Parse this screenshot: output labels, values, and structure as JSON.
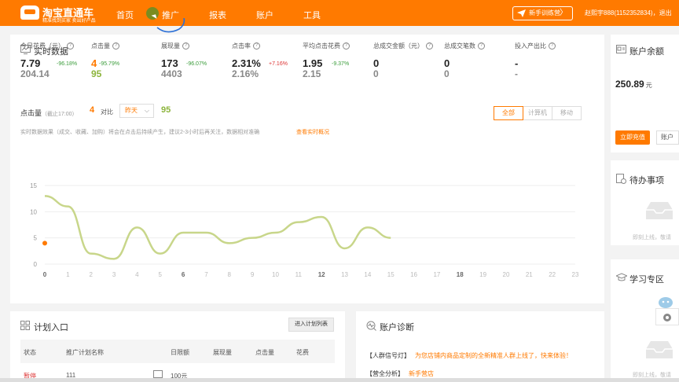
{
  "header": {
    "logo_title": "淘宝直通车",
    "logo_subtitle": "精准找到买家 卖出好产品",
    "nav": [
      "首页",
      "推广",
      "报表",
      "账户",
      "工具"
    ],
    "train_button": "新手训练营",
    "user_info": "赵熙宇888(1152352834)，退出"
  },
  "realtime": {
    "title": "实时数据",
    "metrics": [
      {
        "label": "今日花费（元）",
        "value": "7.79",
        "change": "-96.18%",
        "prev": "204.14",
        "change_dir": "down"
      },
      {
        "label": "点击量",
        "value": "4",
        "change": "-95.79%",
        "prev": "95",
        "change_dir": "down"
      },
      {
        "label": "展现量",
        "value": "173",
        "change": "-96.07%",
        "prev": "4403",
        "change_dir": "down"
      },
      {
        "label": "点击率",
        "value": "2.31%",
        "change": "+7.16%",
        "prev": "2.16%",
        "change_dir": "up"
      },
      {
        "label": "平均点击花费",
        "value": "1.95",
        "change": "-9.37%",
        "prev": "2.15",
        "change_dir": "down"
      },
      {
        "label": "总成交金额（元）",
        "value": "0",
        "change": "",
        "prev": "0",
        "change_dir": "none"
      },
      {
        "label": "总成交笔数",
        "value": "0",
        "change": "",
        "prev": "0",
        "change_dir": "none"
      },
      {
        "label": "投入产出比",
        "value": "-",
        "change": "",
        "prev": "-",
        "change_dir": "none"
      }
    ],
    "clicks_label": "点击量",
    "clicks_time": "（截止17:00）",
    "clicks_today": "4",
    "compare_label": "对比",
    "compare_option": "昨天",
    "clicks_prev": "95",
    "toggles": [
      "全部",
      "计算机",
      "移动"
    ],
    "active_toggle": "全部",
    "note": "实时数据效果（成交、收藏、加购）将会在点击后持续产生，建议2-3小时后再关注，数据相对准确",
    "note_link": "查看实时概况"
  },
  "chart_data": {
    "type": "line",
    "x": [
      0,
      1,
      2,
      3,
      4,
      5,
      6,
      7,
      8,
      9,
      10,
      11,
      12,
      13,
      14,
      15,
      16,
      17,
      18,
      19,
      20,
      21,
      22,
      23
    ],
    "xticks": [
      "0",
      "1",
      "2",
      "3",
      "4",
      "5",
      "6",
      "7",
      "8",
      "9",
      "10",
      "11",
      "12",
      "13",
      "14",
      "15",
      "16",
      "17",
      "18",
      "19",
      "20",
      "21",
      "22",
      "23"
    ],
    "bold_xticks": [
      "0",
      "6",
      "12",
      "18"
    ],
    "yticks": [
      "0",
      "5",
      "10",
      "15"
    ],
    "ylim": [
      0,
      15
    ],
    "xlim": [
      0,
      23
    ],
    "series": [
      {
        "x": [
          0,
          1,
          2,
          3,
          4,
          5,
          6,
          7,
          8,
          9,
          10,
          11,
          12,
          13,
          14,
          15
        ],
        "values": [
          13,
          11,
          2,
          1,
          7,
          2,
          6,
          6,
          4,
          5,
          6,
          8,
          9,
          3,
          7,
          5
        ],
        "color": "#c8d68a"
      },
      {
        "x": [
          0
        ],
        "values": [
          4
        ],
        "color": "#ff7a00"
      }
    ],
    "grid": true
  },
  "balance": {
    "title": "账户余额",
    "value": "250.89",
    "unit": "元",
    "recharge": "立即充值",
    "account": "账户"
  },
  "todo": {
    "title": "待办事项",
    "empty": "即刻上线，敬请"
  },
  "learn": {
    "title": "学习专区",
    "empty": "即刻上线，敬请"
  },
  "plan": {
    "title": "计划入口",
    "button": "进入计划列表",
    "columns": [
      "状态",
      "推广计划名称",
      "日限额",
      "展现量",
      "点击量",
      "花费"
    ],
    "row": {
      "status": "暂停",
      "name": "111",
      "limit": "100元"
    }
  },
  "diagnosis": {
    "title": "账户诊断",
    "lines": [
      {
        "tag": "【人群信号灯】",
        "text": "为您店铺内商品定制的全新精准人群上线了，快来体验！"
      },
      {
        "tag": "【营全分析】",
        "text": "新手营店"
      }
    ]
  },
  "colors": {
    "brand": "#ff7a00",
    "line": "#c8d68a",
    "prev": "#8cb43c"
  }
}
